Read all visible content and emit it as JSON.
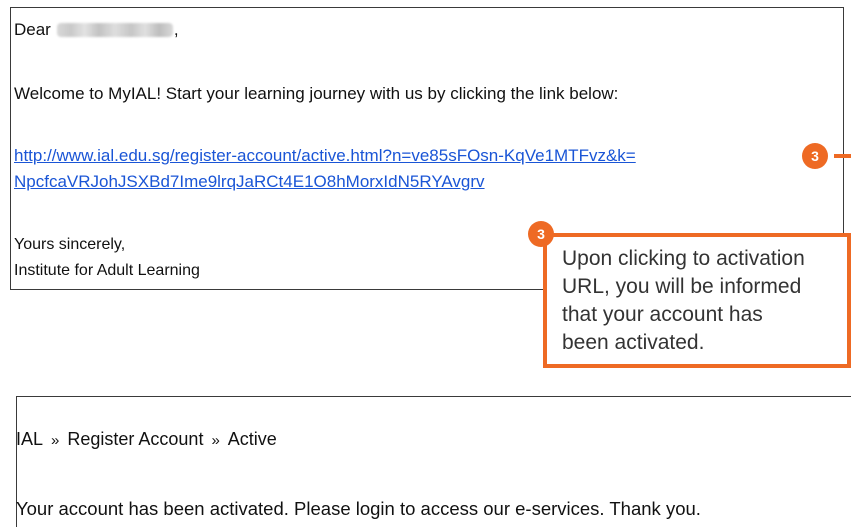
{
  "email": {
    "greeting_prefix": "Dear",
    "greeting_suffix": ",",
    "welcome_text": "Welcome to MyIAL! Start your learning journey with us by clicking the link below:",
    "activation_link_line1": "http://www.ial.edu.sg/register-account/active.html?n=ve85sFOsn-KqVe1MTFvz&k=",
    "activation_link_line2": "NpcfcaVRJohJSXBd7Ime9lrqJaRCt4E1O8hMorxIdN5RYAvgrv",
    "closing": "Yours sincerely,",
    "signature": "Institute for Adult Learning"
  },
  "annotation": {
    "step_number": "3",
    "callout_lines": [
      "Upon clicking to activation",
      "URL, you will be informed",
      "that your account has",
      "been activated."
    ],
    "accent_color": "#ee6a24"
  },
  "confirmation_page": {
    "breadcrumb": [
      "IAL",
      "Register Account",
      "Active"
    ],
    "breadcrumb_separator": "»",
    "message": "Your account has been activated. Please login to access our e-services. Thank you."
  },
  "colors": {
    "link": "#1a55d6",
    "border": "#3a3a3a"
  }
}
